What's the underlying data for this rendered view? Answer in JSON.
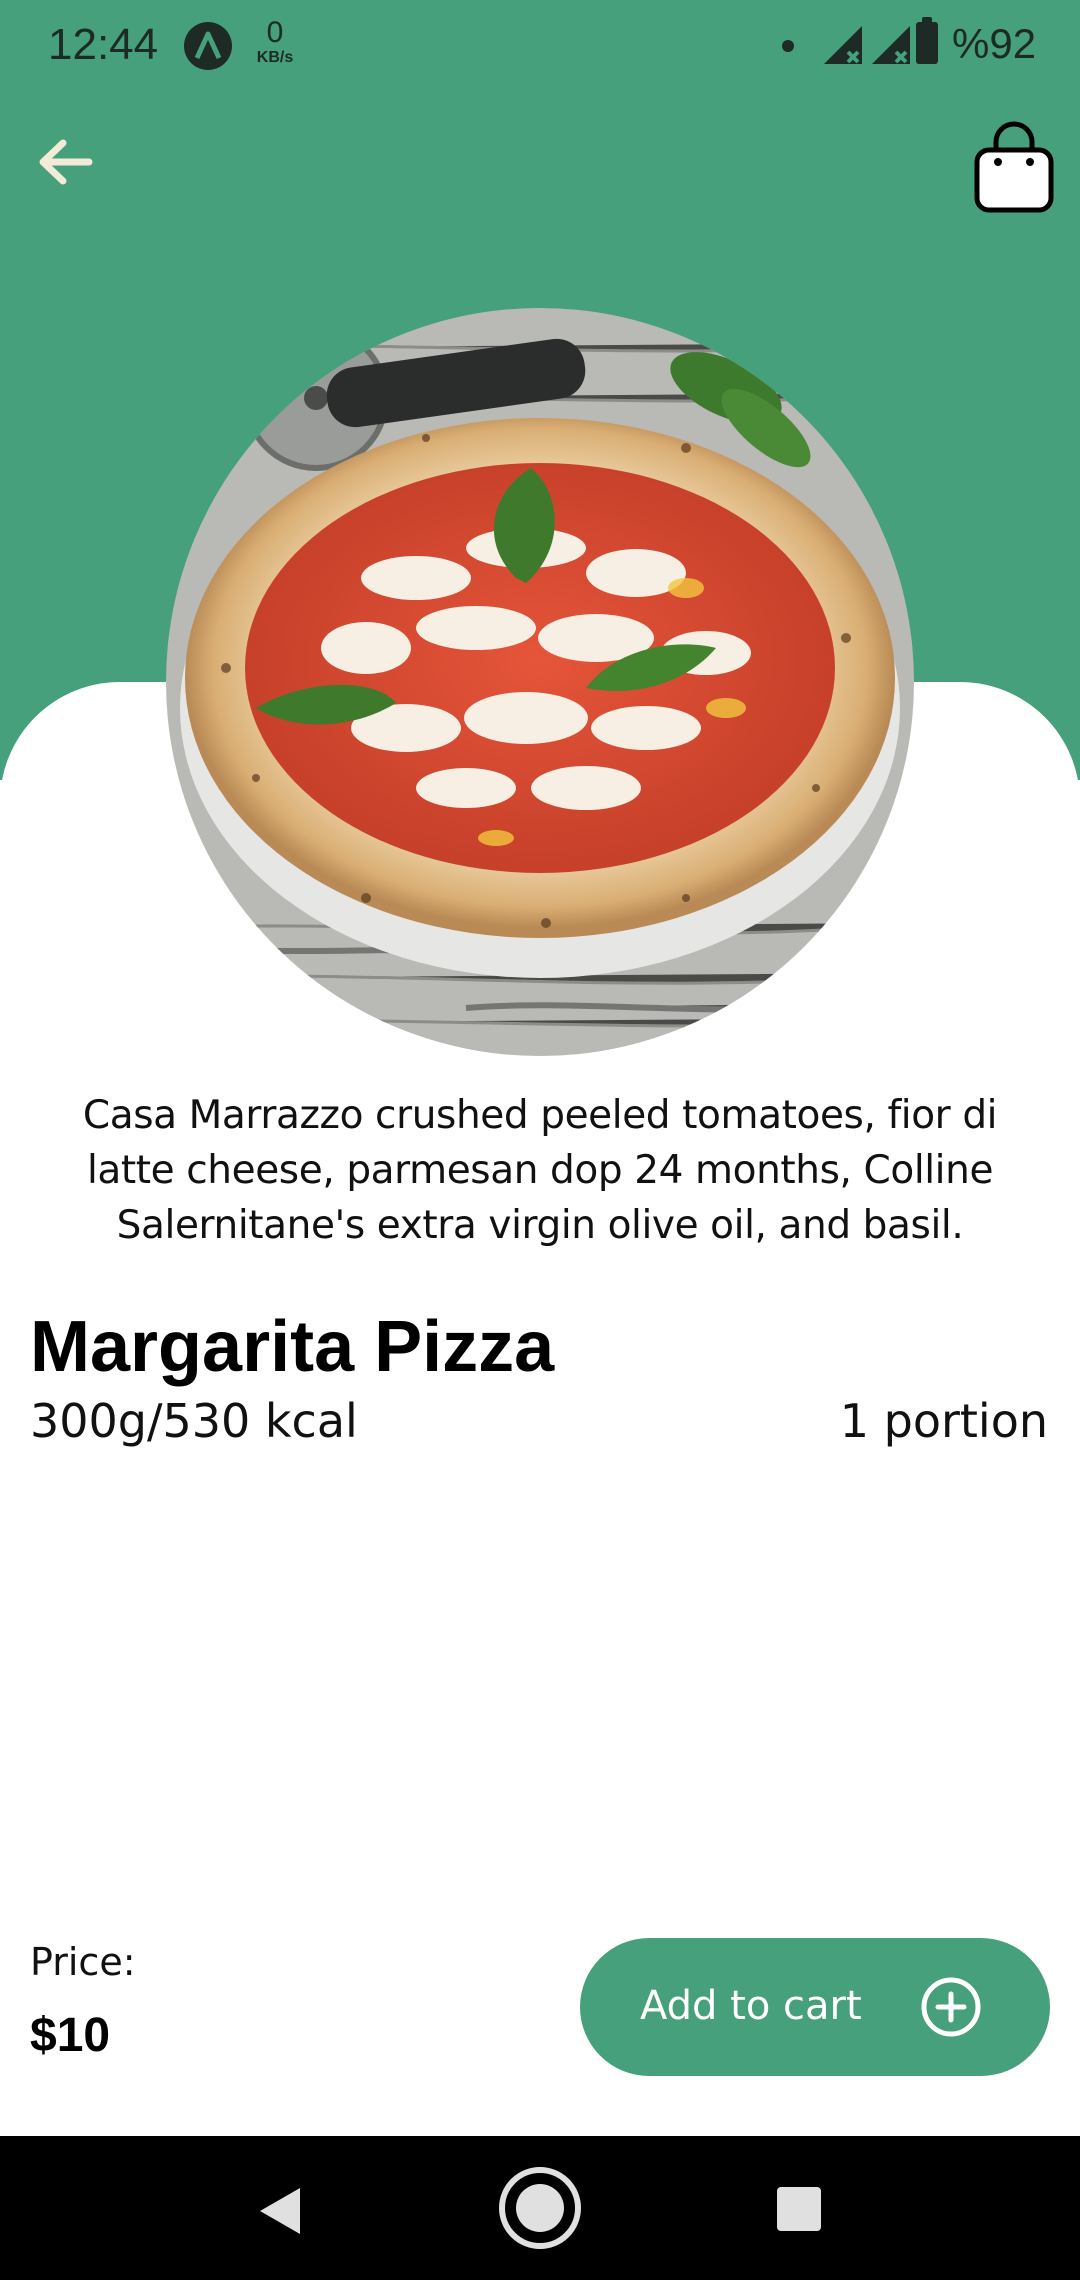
{
  "status_bar": {
    "time": "12:44",
    "net_speed_value": "0",
    "net_speed_unit": "KB/s",
    "battery": "%92",
    "app_icon": "app-a-icon"
  },
  "app_bar": {
    "back_icon": "arrow-left-icon",
    "cart_icon": "shopping-bag-icon"
  },
  "product": {
    "image": "margherita-pizza-photo",
    "description": "Casa Marrazzo crushed peeled tomatoes, fior di latte cheese, parmesan dop 24 months, Colline Salernitane's extra virgin olive oil, and basil.",
    "name": "Margarita Pizza",
    "weight_kcal": "300g/530 kcal",
    "portion": "1 portion"
  },
  "purchase": {
    "price_label": "Price:",
    "price": "$10",
    "add_to_cart_label": "Add to cart",
    "add_icon": "plus-circle-icon"
  },
  "colors": {
    "accent": "#45a07b",
    "background": "#ffffff",
    "nav_bar": "#000000"
  }
}
